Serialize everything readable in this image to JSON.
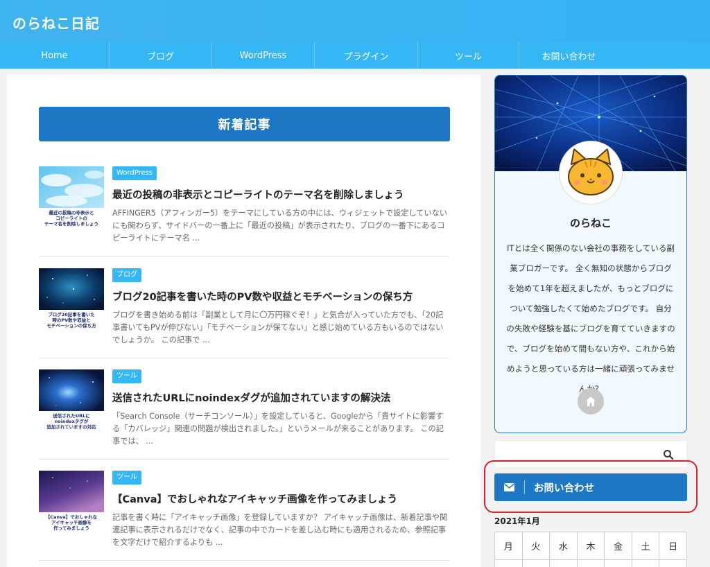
{
  "site": {
    "title": "のらねこ日記"
  },
  "nav": {
    "items": [
      {
        "label": "Home",
        "width": 158
      },
      {
        "label": "ブログ",
        "width": 148
      },
      {
        "label": "WordPress",
        "width": 148
      },
      {
        "label": "プラグイン",
        "width": 149
      },
      {
        "label": "ツール",
        "width": 146
      },
      {
        "label": "お問い合わせ",
        "width": 143
      }
    ]
  },
  "main": {
    "heading": "新着記事",
    "posts": [
      {
        "category": "WordPress",
        "title": "最近の投稿の非表示とコピーライトのテーマ名を削除しましょう",
        "excerpt": "AFFINGER5（アフィンガー5）をテーマにしている方の中には、ウィジェットで設定していないにも関わらず、サイドバーの一番上に「最近の投稿」が表示されたり、ブログの一番下にあるコピーライトにテーマ名 ...",
        "thumb_caption": "最近の投稿の非表示と\nコピーライトの\nテーマ名を削除しましょう"
      },
      {
        "category": "ブログ",
        "title": "ブログ20記事を書いた時のPV数や収益とモチベーションの保ち方",
        "excerpt": "ブログを書き始める前は「副業として月に〇万円稼ぐぞ！」と気合が入っていた方でも、「20記事書いてもPVが伸びない」「モチベーションが保てない」と感じ始めている方もいるのではないでしょうか。 この記事で ...",
        "thumb_caption": "ブログ20記事を書いた\n時のPV数や収益と\nモチベーションの保ち方"
      },
      {
        "category": "ツール",
        "title": "送信されたURLにnoindexダグが追加されていますの解決法",
        "excerpt": "「Search Console（サーチコンソール）」を設定していると、Googleから「貴サイトに影響する「カバレッジ」関連の問題が検出されました。」というメールが来ることがあります。 この記事では、 ...",
        "thumb_caption": "送信されたURLに\nnoindexタグが\n追加されていますの対応"
      },
      {
        "category": "ツール",
        "title": "【Canva】でおしゃれなアイキャッチ画像を作ってみましょう",
        "excerpt": "記事を書く時に「アイキャッチ画像」を登録していますか？ アイキャッチ画像は、新着記事や関連記事に表示されるだけでなく、記事の中でカードを差し込む時にも適用されるため、参照記事を文字だけで紹介するよりも ...",
        "thumb_caption": "【Canva】でおしゃれな\nアイキャッチ画像を\n作ってみましょう"
      }
    ]
  },
  "sidebar": {
    "profile": {
      "name": "のらねこ",
      "description": "ITとは全く関係のない会社の事務をしている副業ブロガーです。 全く無知の状態からブログを始めて1年を超えましたが、もっとブログについて勉強したくて始めたブログです。 自分の失敗や経験を基にブログを育てていきますので、ブログを始めて間もない方や、これから始めようと思っている方は一緒に頑張ってみませんか？"
    },
    "search": {
      "placeholder": ""
    },
    "contact_button": "お問い合わせ",
    "calendar": {
      "title": "2021年1月",
      "weekdays": [
        "月",
        "火",
        "水",
        "木",
        "金",
        "土",
        "日"
      ]
    }
  },
  "colors": {
    "header": "#3fb3ee",
    "nav": "#36b7f5",
    "heading": "#1e77c4",
    "badge": "#36b7f5",
    "highlight": "#d8222e"
  }
}
